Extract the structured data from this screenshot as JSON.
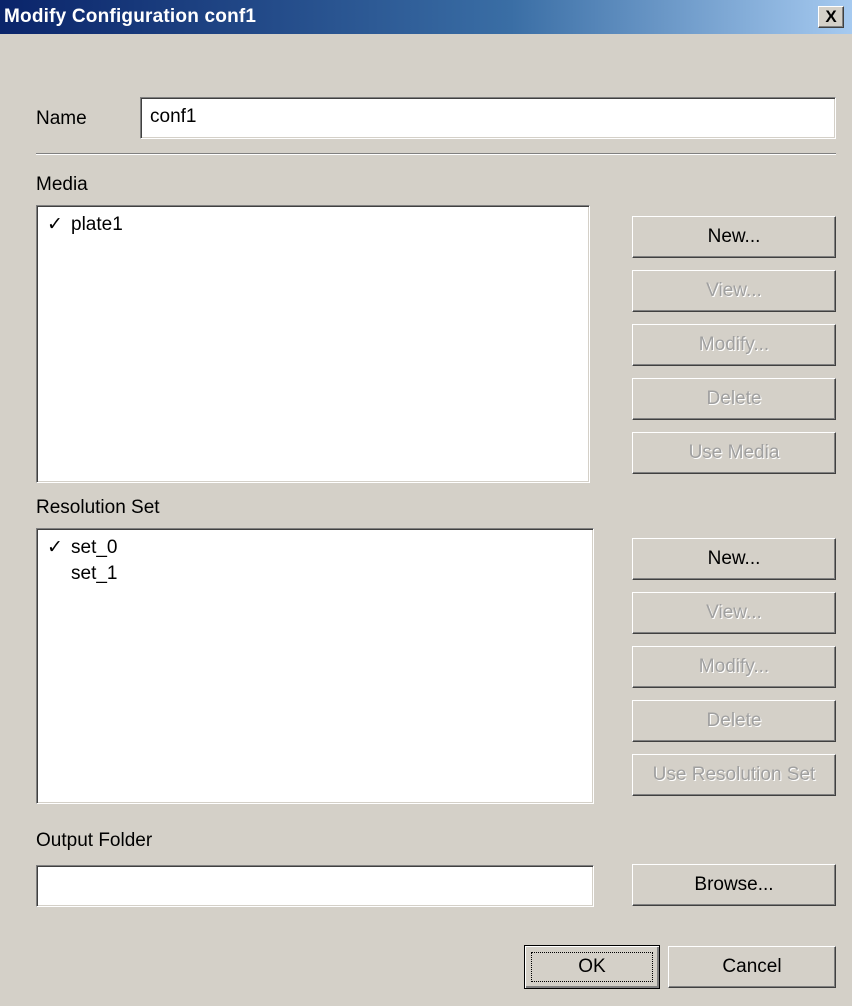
{
  "window": {
    "title": "Modify Configuration conf1",
    "close_label": "X"
  },
  "name": {
    "label": "Name",
    "value": "conf1"
  },
  "media": {
    "label": "Media",
    "items": [
      {
        "name": "plate1",
        "checked": "✓"
      }
    ],
    "buttons": {
      "new": "New...",
      "view": "View...",
      "modify": "Modify...",
      "delete": "Delete",
      "use": "Use Media"
    }
  },
  "resolution": {
    "label": "Resolution Set",
    "items": [
      {
        "name": "set_0",
        "checked": "✓"
      },
      {
        "name": "set_1",
        "checked": ""
      }
    ],
    "buttons": {
      "new": "New...",
      "view": "View...",
      "modify": "Modify...",
      "delete": "Delete",
      "use": "Use Resolution Set"
    }
  },
  "output": {
    "label": "Output Folder",
    "value": "",
    "browse": "Browse..."
  },
  "footer": {
    "ok": "OK",
    "cancel": "Cancel"
  }
}
